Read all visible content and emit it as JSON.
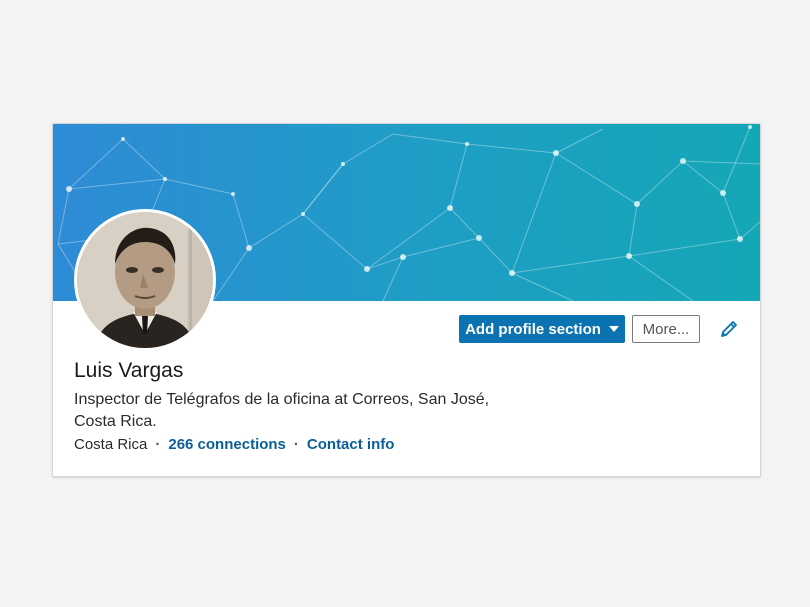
{
  "profile": {
    "name": "Luis Vargas",
    "headline_line1": "Inspector de Telégrafos de la oficina at Correos, San José,",
    "headline_line2": "Costa Rica.",
    "location": "Costa Rica",
    "separator": "·",
    "connections_link": "266 connections",
    "contact_link": "Contact info"
  },
  "actions": {
    "add_section_label": "Add profile section",
    "more_label": "More..."
  },
  "icons": {
    "dropdown": "caret-down-icon",
    "edit": "pencil-icon"
  },
  "colors": {
    "page_background": "#f3f3f3",
    "banner_start": "#2e8bd6",
    "banner_end": "#14a7b6",
    "primary_button": "#0b73b1",
    "link": "#0b5f97",
    "text": "#1a1a1a"
  }
}
